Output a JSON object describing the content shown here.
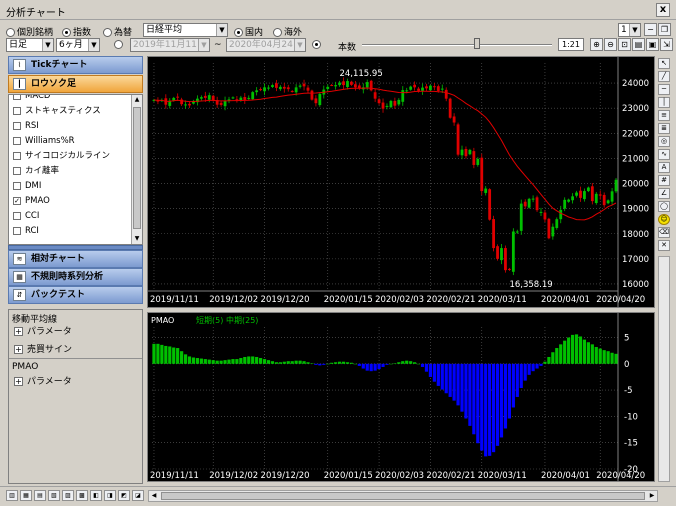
{
  "window": {
    "title": "分析チャート",
    "close": "x"
  },
  "row1": {
    "mode_radios": [
      {
        "label": "個別銘柄",
        "checked": false
      },
      {
        "label": "指数",
        "checked": true
      },
      {
        "label": "為替",
        "checked": false
      }
    ],
    "index_select": "日経平均",
    "market_radios": [
      {
        "label": "国内",
        "checked": true
      },
      {
        "label": "海外",
        "checked": false
      }
    ],
    "layout_select": "1"
  },
  "row2": {
    "bar_select": "日足",
    "period_select": "6ヶ月",
    "date_from": "2019年11月11日",
    "tilde": "~",
    "date_to": "2020年04月24日",
    "count_label": "本数",
    "ratio": "1:21"
  },
  "left": {
    "tick_chart": "Tickチャート",
    "candle": "ロウソク足",
    "indicators": [
      {
        "label": "MACD",
        "checked": false
      },
      {
        "label": "ストキャスティクス",
        "checked": false
      },
      {
        "label": "RSI",
        "checked": false
      },
      {
        "label": "Williams%R",
        "checked": false
      },
      {
        "label": "サイコロジカルライン",
        "checked": false
      },
      {
        "label": "カイ離率",
        "checked": false
      },
      {
        "label": "DMI",
        "checked": false
      },
      {
        "label": "PMAO",
        "checked": true
      },
      {
        "label": "CCI",
        "checked": false
      },
      {
        "label": "RCI",
        "checked": false
      }
    ],
    "relative_chart": "相対チャート",
    "irregular": "不規則時系列分析",
    "backtest": "バックテスト",
    "settings": [
      {
        "title": "移動平均線",
        "items": [
          "パラメータ",
          "売買サイン"
        ]
      },
      {
        "title": "PMAO",
        "items": [
          "パラメータ"
        ]
      }
    ]
  },
  "colors": {
    "up": "#00c000",
    "down": "#e00000",
    "ma": "#e00000",
    "pmao_pos": "#00c000",
    "pmao_neg": "#0000ff",
    "grid": "#606060"
  },
  "chart_data": [
    {
      "type": "candlestick",
      "title": "",
      "ylim": [
        15800,
        24800
      ],
      "yticks": [
        16000,
        17000,
        18000,
        19000,
        20000,
        21000,
        22000,
        23000,
        24000
      ],
      "xticks": [
        "2019/11/11",
        "2019/12/02",
        "2019/12/20",
        "2020/01/15",
        "2020/02/03",
        "2020/02/21",
        "2020/03/11",
        "2020/04/01",
        "2020/04/20"
      ],
      "xtick_index": [
        0,
        15,
        28,
        44,
        57,
        70,
        83,
        99,
        113
      ],
      "n": 118,
      "high_annotation": "24,115.95",
      "low_annotation": "16,358.19",
      "close": [
        23330,
        23290,
        23320,
        23140,
        23300,
        23410,
        23420,
        23160,
        23150,
        23110,
        23290,
        23380,
        23440,
        23410,
        23520,
        23300,
        23140,
        23130,
        23300,
        23350,
        23430,
        23350,
        23420,
        23330,
        23410,
        23640,
        23710,
        23750,
        23830,
        23820,
        23920,
        23810,
        23850,
        23780,
        23760,
        23660,
        23830,
        23900,
        23870,
        23700,
        23340,
        23200,
        23570,
        23740,
        23850,
        23920,
        23920,
        24020,
        23920,
        24080,
        23930,
        23830,
        23800,
        23830,
        24040,
        23710,
        23380,
        23200,
        22980,
        23090,
        23290,
        23100,
        23330,
        23720,
        23710,
        23860,
        23830,
        23690,
        23820,
        23790,
        23900,
        23850,
        23690,
        23780,
        23380,
        22620,
        22430,
        21150,
        21350,
        21090,
        21340,
        20740,
        20980,
        19700,
        19800,
        18560,
        17430,
        17000,
        17430,
        16550,
        16560,
        18090,
        18090,
        19200,
        19090,
        19390,
        19400,
        18940,
        18870,
        18570,
        17820,
        18280,
        18580,
        18950,
        19350,
        19360,
        19490,
        19640,
        19430,
        19700,
        19840,
        19300,
        19590,
        19520,
        19140,
        19330,
        19690,
        20150
      ],
      "ma": {
        "label": "移動平均",
        "period": 25
      }
    },
    {
      "type": "bar",
      "title": "PMAO",
      "legend_items": [
        "短期(5)",
        "中期(25)"
      ],
      "ylim": [
        -20,
        7
      ],
      "yticks": [
        5,
        0,
        -5,
        -10,
        -15,
        -20
      ],
      "xticks": [
        "2019/11/11",
        "2019/12/02",
        "2019/12/20",
        "2020/01/15",
        "2020/02/03",
        "2020/02/21",
        "2020/03/11",
        "2020/04/01",
        "2020/04/20"
      ],
      "values": [
        3.8,
        3.8,
        3.6,
        3.4,
        3.3,
        3.1,
        3.0,
        2.4,
        1.8,
        1.4,
        1.2,
        1.1,
        1.0,
        0.9,
        0.8,
        0.7,
        0.6,
        0.6,
        0.7,
        0.8,
        0.9,
        0.9,
        1.1,
        1.3,
        1.4,
        1.4,
        1.3,
        1.1,
        0.9,
        0.7,
        0.5,
        0.3,
        0.3,
        0.4,
        0.5,
        0.5,
        0.6,
        0.6,
        0.5,
        0.3,
        0.1,
        -0.2,
        -0.3,
        -0.2,
        0.0,
        0.2,
        0.3,
        0.4,
        0.4,
        0.3,
        0.2,
        0.0,
        -0.4,
        -0.9,
        -1.3,
        -1.4,
        -1.3,
        -1.0,
        -0.6,
        -0.2,
        0.0,
        0.1,
        0.3,
        0.5,
        0.6,
        0.5,
        0.3,
        0.0,
        -0.6,
        -1.5,
        -2.5,
        -3.4,
        -4.2,
        -4.9,
        -5.6,
        -6.3,
        -7.0,
        -7.9,
        -9.1,
        -10.4,
        -11.8,
        -13.4,
        -15.1,
        -16.5,
        -17.6,
        -17.5,
        -16.8,
        -15.6,
        -14.0,
        -12.3,
        -10.4,
        -8.3,
        -6.3,
        -4.6,
        -3.2,
        -2.1,
        -1.4,
        -0.9,
        -0.4,
        0.4,
        1.3,
        2.2,
        3.0,
        3.7,
        4.4,
        5.0,
        5.5,
        5.6,
        5.2,
        4.6,
        4.1,
        3.7,
        3.2,
        2.9,
        2.6,
        2.4,
        2.1,
        1.9
      ]
    }
  ]
}
